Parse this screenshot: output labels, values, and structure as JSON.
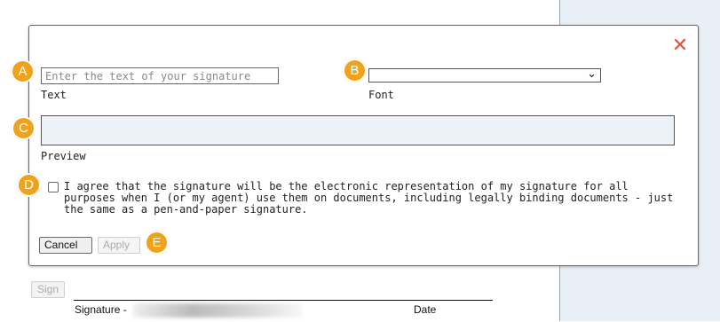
{
  "dialog": {
    "close_icon": "close-x-icon",
    "text_input": {
      "placeholder": "Enter the text of your signature",
      "value": ""
    },
    "text_label": "Text",
    "font_select": {
      "selected": ""
    },
    "font_label": "Font",
    "preview_label": "Preview",
    "agreement": "I agree that the signature will be the electronic representation of my signature for all purposes when I (or my agent) use them on documents, including legally binding documents - just the same as a pen-and-paper signature.",
    "agreement_checked": false,
    "cancel_label": "Cancel",
    "apply_label": "Apply"
  },
  "markers": {
    "a": "A",
    "b": "B",
    "c": "C",
    "d": "D",
    "e": "E"
  },
  "page": {
    "sign_button": "Sign",
    "signature_label": "Signature -",
    "date_label": "Date"
  },
  "colors": {
    "marker": "#f0a21b",
    "close": "#e0533a",
    "preview_bg": "#edf2f8"
  }
}
